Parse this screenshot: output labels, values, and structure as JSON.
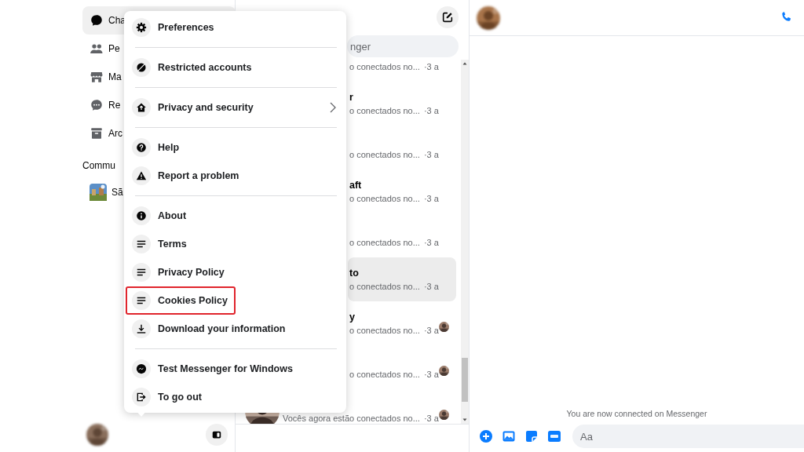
{
  "sidebar": {
    "items": [
      {
        "label": "Cha",
        "selected": true
      },
      {
        "label": "Pe",
        "selected": false
      },
      {
        "label": "Ma",
        "selected": false
      },
      {
        "label": "Re",
        "selected": false
      },
      {
        "label": "Arc",
        "selected": false
      }
    ],
    "section_heading": "Commu",
    "communities": [
      {
        "label": "Sã"
      }
    ]
  },
  "chat_list": {
    "search": {
      "placeholder": "nger"
    },
    "rows": [
      {
        "kind": "under-menu",
        "subtitle": "o conectados no...",
        "time": "·3 a",
        "selected": false,
        "seen": false
      },
      {
        "kind": "under-menu",
        "name": "r",
        "subtitle": "o conectados no...",
        "time": "·3 a",
        "selected": false,
        "seen": false
      },
      {
        "kind": "under-menu",
        "subtitle": "o conectados no...",
        "time": "·3 a",
        "selected": false,
        "seen": false
      },
      {
        "kind": "under-menu",
        "name": "aft",
        "subtitle": "o conectados no...",
        "time": "·3 a",
        "selected": false,
        "seen": false
      },
      {
        "kind": "under-menu",
        "subtitle": "o conectados no...",
        "time": "·3 a",
        "selected": false,
        "seen": false
      },
      {
        "kind": "under-menu",
        "name": "to",
        "subtitle": "o conectados no...",
        "time": "·3 a",
        "selected": true,
        "seen": false
      },
      {
        "kind": "under-menu",
        "name": "y",
        "subtitle": "o conectados no...",
        "time": "·3 a",
        "selected": false,
        "seen": true
      },
      {
        "kind": "under-menu",
        "subtitle": "o conectados no...",
        "time": "·3 a",
        "selected": false,
        "seen": true
      },
      {
        "kind": "full",
        "subtitle": "Vocês agora estão conectados no...",
        "time": "·3 a",
        "selected": false,
        "seen": true
      }
    ]
  },
  "menu": {
    "groups": [
      [
        {
          "label": "Preferences",
          "submenu": false,
          "highlighted": false
        }
      ],
      [
        {
          "label": "Restricted accounts",
          "submenu": false,
          "highlighted": false
        }
      ],
      [
        {
          "label": "Privacy and security",
          "submenu": true,
          "highlighted": false
        }
      ],
      [
        {
          "label": "Help",
          "submenu": false,
          "highlighted": false
        },
        {
          "label": "Report a problem",
          "submenu": false,
          "highlighted": false
        }
      ],
      [
        {
          "label": "About",
          "submenu": false,
          "highlighted": false
        },
        {
          "label": "Terms",
          "submenu": false,
          "highlighted": false
        },
        {
          "label": "Privacy Policy",
          "submenu": false,
          "highlighted": false
        },
        {
          "label": "Cookies Policy",
          "submenu": false,
          "highlighted": true
        },
        {
          "label": "Download your information",
          "submenu": false,
          "highlighted": false
        }
      ],
      [
        {
          "label": "Test Messenger for Windows",
          "submenu": false,
          "highlighted": false
        },
        {
          "label": "To go out",
          "submenu": false,
          "highlighted": false
        }
      ]
    ]
  },
  "conversation": {
    "notice": "You are now connected on Messenger",
    "composer": {
      "placeholder": "Aa"
    }
  }
}
